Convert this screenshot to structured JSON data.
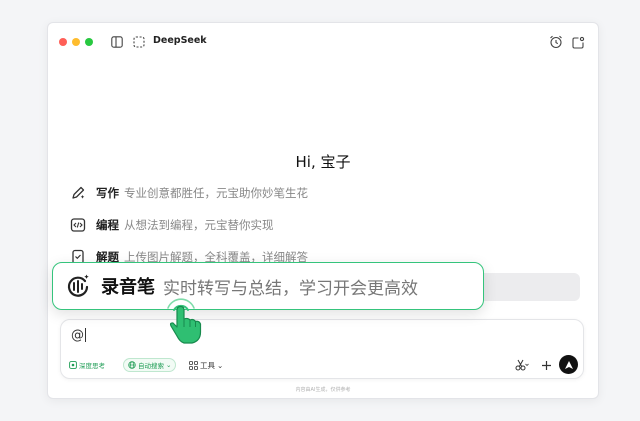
{
  "titlebar": {
    "model_name": "DeepSeek",
    "icons": [
      "sidebar-toggle-icon",
      "dashed-frame-icon",
      "alarm-icon",
      "new-chat-icon"
    ]
  },
  "greeting": "Hi, 宝子",
  "suggestions": [
    {
      "icon": "pen-icon",
      "title": "写作",
      "desc": "专业创意都胜任，元宝助你妙笔生花"
    },
    {
      "icon": "code-icon",
      "title": "编程",
      "desc": "从想法到编程，元宝替你实现"
    },
    {
      "icon": "solve-icon",
      "title": "解题",
      "desc": "上传图片解题，全科覆盖，详细解答"
    }
  ],
  "callout": {
    "icon": "recorder-icon",
    "title": "录音笔",
    "desc": "实时转写与总结，学习开会更高效"
  },
  "input": {
    "value": "@",
    "chips": {
      "deep_think": "深度思考",
      "auto_search": "自动搜索",
      "tools": "工具"
    }
  },
  "footnote": "内容由AI生成，仅供参考",
  "colors": {
    "accent_green": "#35c47c",
    "chip_green": "#1f9d55",
    "send_bg": "#111111"
  }
}
